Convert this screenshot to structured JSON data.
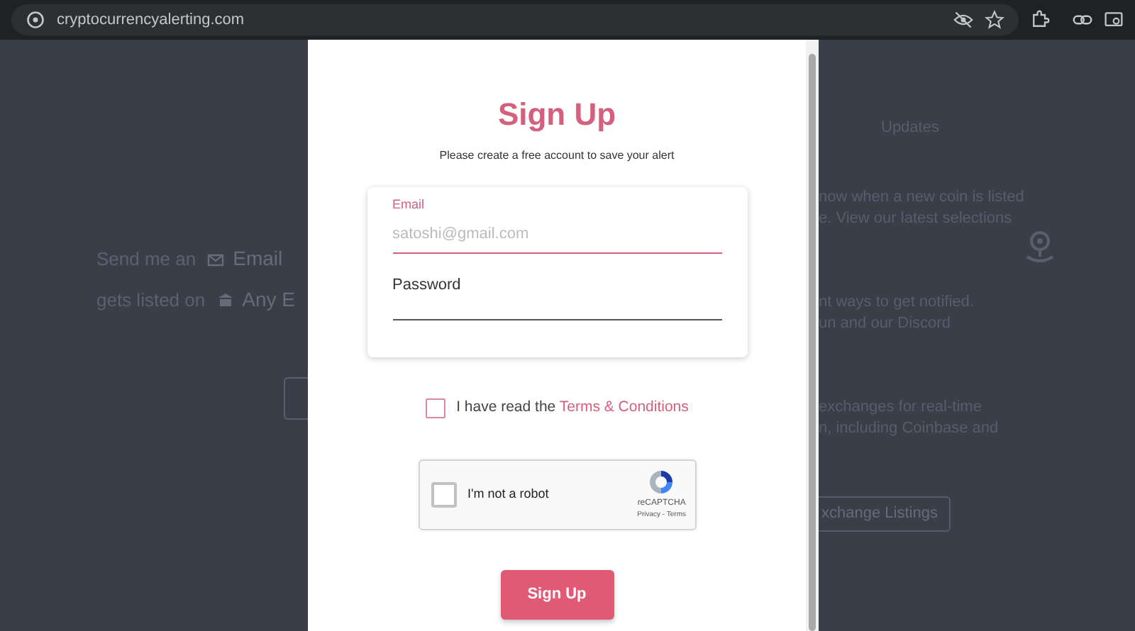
{
  "browser": {
    "url": "cryptocurrencyalerting.com"
  },
  "background": {
    "left_lines": [
      {
        "text": "Send me an",
        "chip": "Email"
      },
      {
        "text": "gets listed on",
        "chip": "Any E"
      }
    ],
    "right_heading": "Updates",
    "right_paragraphs": [
      [
        "now when a new coin is listed",
        "e. View our latest selections"
      ],
      [
        "nt ways to get notified.",
        "un and our Discord"
      ],
      [
        "exchanges for real-time",
        "n, including Coinbase and"
      ]
    ],
    "right_button": "xchange Listings"
  },
  "modal": {
    "title": "Sign Up",
    "subtitle": "Please create a free account to save your alert",
    "fields": [
      {
        "label": "Email",
        "placeholder": "satoshi@gmail.com",
        "focused": true
      },
      {
        "label": "Password",
        "focused": false
      }
    ],
    "terms": {
      "text": "I have read the ",
      "link": "Terms & Conditions",
      "checked": false
    },
    "captcha": {
      "label": "I'm not a robot",
      "brand": "reCAPTCHA",
      "links": "Privacy - Terms",
      "checked": false
    },
    "submit": "Sign Up"
  }
}
